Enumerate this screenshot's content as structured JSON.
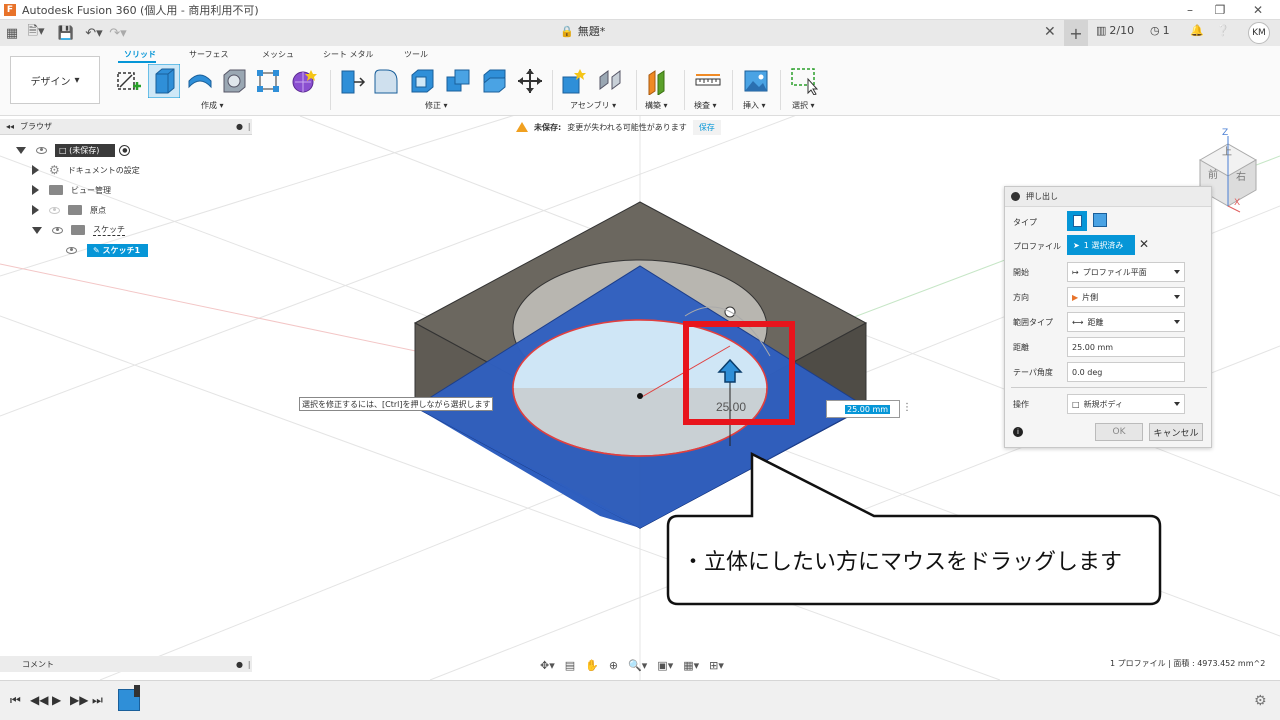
{
  "window": {
    "title": "Autodesk Fusion 360 (個人用 - 商用利用不可)",
    "app_icon": "F"
  },
  "tabbar": {
    "doc_title": "無題*",
    "jobs": "2/10",
    "notifications": "1",
    "user_initials": "KM"
  },
  "ribbon": {
    "workspace": "デザイン",
    "tabs": [
      "ソリッド",
      "サーフェス",
      "メッシュ",
      "シート メタル",
      "ツール"
    ],
    "active_tab": "ソリッド",
    "groups": [
      "作成",
      "修正",
      "アセンブリ",
      "構築",
      "検査",
      "挿入",
      "選択"
    ]
  },
  "warning": {
    "label": "未保存:",
    "message": "変更が失われる可能性があります",
    "save": "保存"
  },
  "browser": {
    "title": "ブラウザ",
    "items": [
      {
        "label": "(未保存)"
      },
      {
        "label": "ドキュメントの設定"
      },
      {
        "label": "ビュー管理"
      },
      {
        "label": "原点"
      },
      {
        "label": "スケッチ"
      },
      {
        "label": "スケッチ1"
      }
    ]
  },
  "comments": {
    "title": "コメント"
  },
  "dialog": {
    "title": "押し出し",
    "type_label": "タイプ",
    "profile_label": "プロファイル",
    "profile_value": "1 選択済み",
    "start_label": "開始",
    "start_value": "プロファイル平面",
    "direction_label": "方向",
    "direction_value": "片側",
    "extent_label": "範囲タイプ",
    "extent_value": "距離",
    "distance_label": "距離",
    "distance_value": "25.00 mm",
    "taper_label": "テーパ角度",
    "taper_value": "0.0 deg",
    "operation_label": "操作",
    "operation_value": "新規ボディ",
    "ok": "OK",
    "cancel": "キャンセル"
  },
  "viewport": {
    "hint": "選択を修正するには、[Ctrl]を押しながら選択します",
    "inline_value": "25.00 mm",
    "dimension_text": "25.00",
    "callout": "・立体にしたい方にマウスをドラッグします",
    "viewcube": {
      "top": "上",
      "front": "前",
      "right": "右",
      "z": "Z",
      "x": "X"
    }
  },
  "status": {
    "selection": "1 プロファイル | 面積 : 4973.452 mm^2"
  },
  "colors": {
    "accent": "#0696d7",
    "profile_blue": "#2f5fbf",
    "box_gray": "#6b675f",
    "highlight_red": "#e8141c"
  }
}
